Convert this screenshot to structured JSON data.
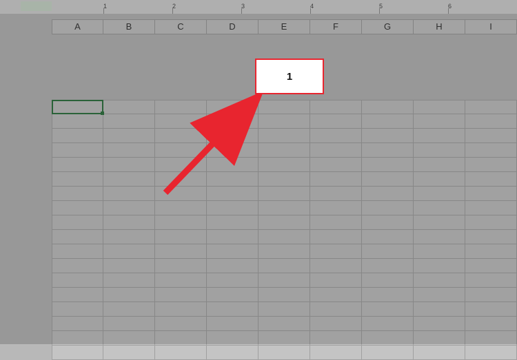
{
  "ruler": {
    "marks": [
      "1",
      "2",
      "3",
      "4",
      "5",
      "6"
    ]
  },
  "columns": [
    "A",
    "B",
    "C",
    "D",
    "E",
    "F",
    "G",
    "H",
    "I"
  ],
  "grid": {
    "rows": 18,
    "cols": 9
  },
  "selected_cell": {
    "column": "A",
    "row": 1
  },
  "callout": {
    "value": "1"
  },
  "annotation": {
    "arrow_color": "#e8252f",
    "box_border_color": "#e8252f"
  }
}
